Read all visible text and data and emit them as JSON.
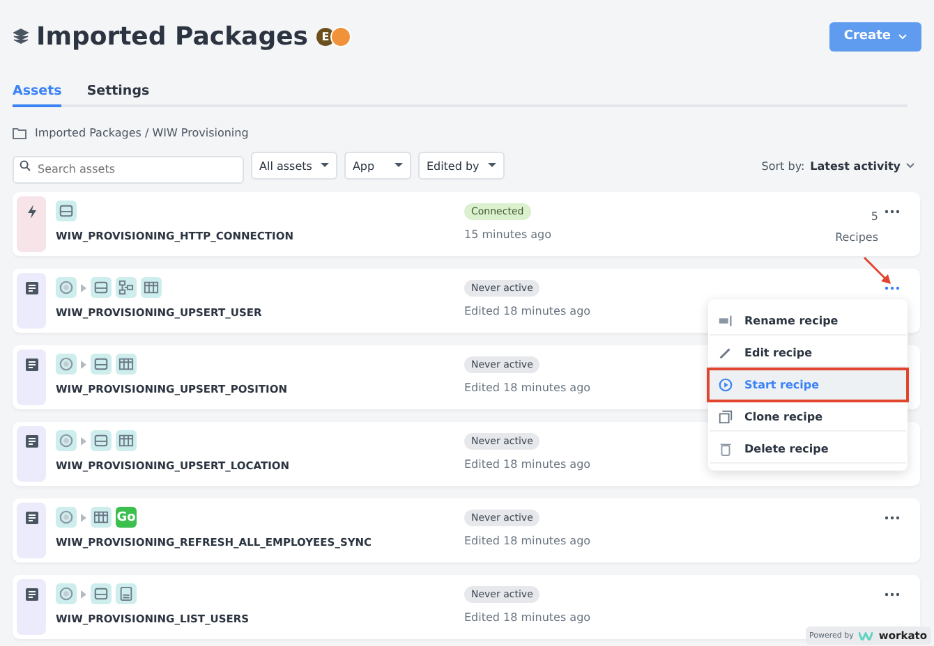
{
  "header": {
    "title": "Imported Packages",
    "avatar_initial": "E",
    "create_button": "Create"
  },
  "tabs": [
    {
      "label": "Assets",
      "selected": true
    },
    {
      "label": "Settings",
      "selected": false
    }
  ],
  "breadcrumb": "Imported Packages / WIW Provisioning",
  "toolbar": {
    "search_placeholder": "Search assets",
    "filters": [
      "All assets",
      "App",
      "Edited by"
    ],
    "sort_label": "Sort by:",
    "sort_value": "Latest activity"
  },
  "assets": [
    {
      "kind": "connection",
      "name": "WIW_PROVISIONING_HTTP_CONNECTION",
      "apps": [
        {
          "kind": "http"
        }
      ],
      "status": {
        "label": "Connected",
        "kind": "connected"
      },
      "time": "15 minutes ago",
      "count": "5",
      "count_label": "Recipes",
      "menu_open": false
    },
    {
      "kind": "recipe",
      "name": "WIW_PROVISIONING_UPSERT_USER",
      "apps": [
        {
          "kind": "trigger"
        },
        {
          "kind": "http"
        },
        {
          "kind": "workflow"
        },
        {
          "kind": "table"
        }
      ],
      "status": {
        "label": "Never active",
        "kind": "inactive"
      },
      "time": "Edited 18 minutes ago",
      "menu_open": true
    },
    {
      "kind": "recipe",
      "name": "WIW_PROVISIONING_UPSERT_POSITION",
      "apps": [
        {
          "kind": "trigger"
        },
        {
          "kind": "http"
        },
        {
          "kind": "table"
        }
      ],
      "status": {
        "label": "Never active",
        "kind": "inactive"
      },
      "time": "Edited 18 minutes ago",
      "menu_open": false
    },
    {
      "kind": "recipe",
      "name": "WIW_PROVISIONING_UPSERT_LOCATION",
      "apps": [
        {
          "kind": "trigger"
        },
        {
          "kind": "http"
        },
        {
          "kind": "table"
        }
      ],
      "status": {
        "label": "Never active",
        "kind": "inactive"
      },
      "time": "Edited 18 minutes ago",
      "menu_open": false
    },
    {
      "kind": "recipe",
      "name": "WIW_PROVISIONING_REFRESH_ALL_EMPLOYEES_SYNC",
      "apps": [
        {
          "kind": "trigger"
        },
        {
          "kind": "table"
        },
        {
          "kind": "go",
          "label": "Go"
        }
      ],
      "status": {
        "label": "Never active",
        "kind": "inactive"
      },
      "time": "Edited 18 minutes ago",
      "menu_open": false
    },
    {
      "kind": "recipe",
      "name": "WIW_PROVISIONING_LIST_USERS",
      "apps": [
        {
          "kind": "trigger"
        },
        {
          "kind": "http"
        },
        {
          "kind": "doc"
        }
      ],
      "status": {
        "label": "Never active",
        "kind": "inactive"
      },
      "time": "Edited 18 minutes ago",
      "menu_open": false
    }
  ],
  "menu": [
    {
      "label": "Rename recipe",
      "selected": false
    },
    {
      "label": "Edit recipe",
      "selected": false
    },
    {
      "label": "Start recipe",
      "selected": true
    },
    {
      "label": "Clone recipe",
      "selected": false
    },
    {
      "label": "Delete recipe",
      "selected": false
    }
  ],
  "powered_by": {
    "label": "Powered by",
    "brand": "workato"
  }
}
